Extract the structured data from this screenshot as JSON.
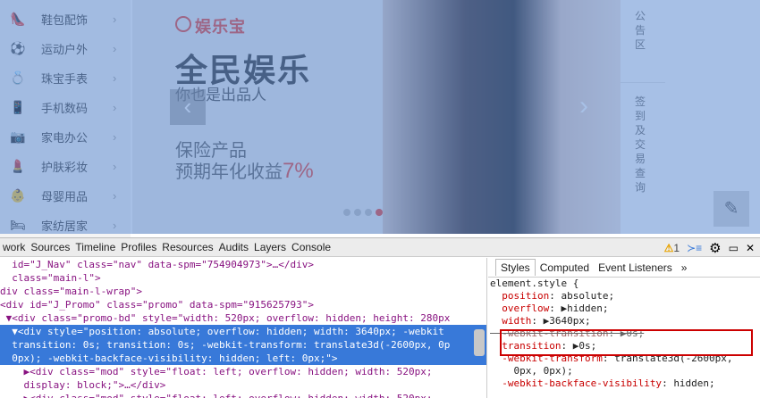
{
  "sidebar": {
    "items": [
      {
        "label": "鞋包配饰",
        "icon": "shoe-icon"
      },
      {
        "label": "运动户外",
        "icon": "ball-icon"
      },
      {
        "label": "珠宝手表",
        "icon": "jewel-icon"
      },
      {
        "label": "手机数码",
        "icon": "phone-icon"
      },
      {
        "label": "家电办公",
        "icon": "appliance-icon"
      },
      {
        "label": "护肤彩妆",
        "icon": "cosmetic-icon"
      },
      {
        "label": "母婴用品",
        "icon": "baby-icon"
      },
      {
        "label": "家纺居家",
        "icon": "home-icon"
      }
    ],
    "arrow": "›"
  },
  "banner": {
    "brand": "娱乐宝",
    "headline": "全民娱乐",
    "sub": "你也是出品人",
    "promo_line1": "保险产品",
    "promo_line2": "预期年化收益",
    "promo_rate": "7%",
    "prev": "‹",
    "next": "›"
  },
  "rightcol": {
    "notice": "公告区",
    "sign": "签到及交易查询"
  },
  "devtools": {
    "tabs": [
      "work",
      "Sources",
      "Timeline",
      "Profiles",
      "Resources",
      "Audits",
      "Layers",
      "Console"
    ],
    "warning_count": "1",
    "elements": [
      {
        "text": "  id=\"J_Nav\" class=\"nav\" data-spm=\"754904973\">…</div>",
        "selected": false
      },
      {
        "text": "  class=\"main-l\">",
        "selected": false
      },
      {
        "text": "div class=\"main-l-wrap\">",
        "selected": false
      },
      {
        "text": "<div id=\"J_Promo\" class=\"promo\" data-spm=\"915625793\">",
        "selected": false
      },
      {
        "text": " ▼<div class=\"promo-bd\" style=\"width: 520px; overflow: hidden; height: 280px",
        "selected": false
      },
      {
        "text": "  ▼<div style=\"position: absolute; overflow: hidden; width: 3640px; -webkit",
        "selected": true
      },
      {
        "text": "  transition: 0s; transition: 0s; -webkit-transform: translate3d(-2600px, 0p",
        "selected": true
      },
      {
        "text": "  0px); -webkit-backface-visibility: hidden; left: 0px;\">",
        "selected": true
      },
      {
        "text": "    ▶<div class=\"mod\" style=\"float: left; overflow: hidden; width: 520px;",
        "selected": false
      },
      {
        "text": "    display: block;\">…</div>",
        "selected": false
      },
      {
        "text": "    ▶<div class=\"mod\" style=\"float: left; overflow: hidden; width: 520px;",
        "selected": false
      }
    ],
    "styles": {
      "tabs": [
        "Styles",
        "Computed",
        "Event Listeners",
        "»"
      ],
      "selector": "element.style {",
      "rules": [
        {
          "name": "position",
          "value": "absolute;",
          "struck": false
        },
        {
          "name": "overflow",
          "value": "▶hidden;",
          "struck": false
        },
        {
          "name": "width",
          "value": "▶3640px;",
          "struck": false
        },
        {
          "name": "-webkit-transition",
          "value": "▶0s;",
          "struck": true
        },
        {
          "name": "transition",
          "value": "▶0s;",
          "struck": false
        },
        {
          "name": "-webkit-transform",
          "value": "translate3d(-2600px,",
          "struck": false
        },
        {
          "name": "",
          "value": "    0px, 0px);",
          "struck": false
        },
        {
          "name": "-webkit-backface-visibility",
          "value": "hidden;",
          "struck": false
        }
      ]
    }
  }
}
